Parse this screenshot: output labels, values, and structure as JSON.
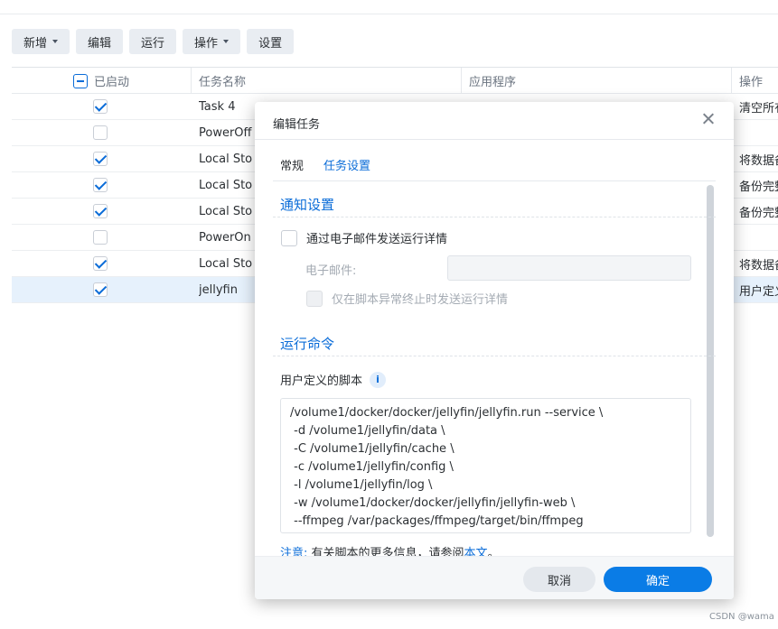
{
  "toolbar": {
    "new_label": "新增",
    "edit_label": "编辑",
    "run_label": "运行",
    "action_label": "操作",
    "settings_label": "设置"
  },
  "grid": {
    "columns": {
      "enabled": "已启动",
      "task_name": "任务名称",
      "application": "应用程序",
      "action": "操作"
    },
    "rows": [
      {
        "checked": true,
        "name": "Task 4",
        "action": "清空所有"
      },
      {
        "checked": false,
        "name": "PowerOff",
        "action": ""
      },
      {
        "checked": true,
        "name": "Local Stora",
        "action": "将数据备"
      },
      {
        "checked": true,
        "name": "Local Stora",
        "action": "备份完整"
      },
      {
        "checked": true,
        "name": "Local Stora",
        "action": "备份完整"
      },
      {
        "checked": false,
        "name": "PowerOn",
        "action": ""
      },
      {
        "checked": true,
        "name": "Local Stora",
        "action": "将数据备"
      },
      {
        "checked": true,
        "name": "jellyfin",
        "action": "用户定义"
      }
    ]
  },
  "dialog": {
    "title": "编辑任务",
    "tabs": [
      "常规",
      "任务设置"
    ],
    "active_tab": "任务设置",
    "notify_section": "通知设置",
    "email_option": "通过电子邮件发送运行详情",
    "email_label": "电子邮件:",
    "email_value": "",
    "abort_option": "仅在脚本异常终止时发送运行详情",
    "command_section": "运行命令",
    "script_label": "用户定义的脚本",
    "script_lines": [
      "/volume1/docker/docker/jellyfin/jellyfin.run --service \\",
      " -d /volume1/jellyfin/data \\",
      " -C /volume1/jellyfin/cache \\",
      " -c /volume1/jellyfin/config \\",
      " -l /volume1/jellyfin/log \\",
      " -w /volume1/docker/docker/jellyfin/jellyfin-web \\",
      " --ffmpeg /var/packages/ffmpeg/target/bin/ffmpeg"
    ],
    "note_prefix": "注意:",
    "note_text": "有关脚本的更多信息，请参阅",
    "note_link": "本文",
    "note_end": "。",
    "cancel_label": "取消",
    "ok_label": "确定"
  },
  "watermark": "CSDN @wama",
  "colors": {
    "accent": "#0a6cd8",
    "primary_button": "#0a7ce6",
    "selected_row": "#e6f1fc"
  }
}
